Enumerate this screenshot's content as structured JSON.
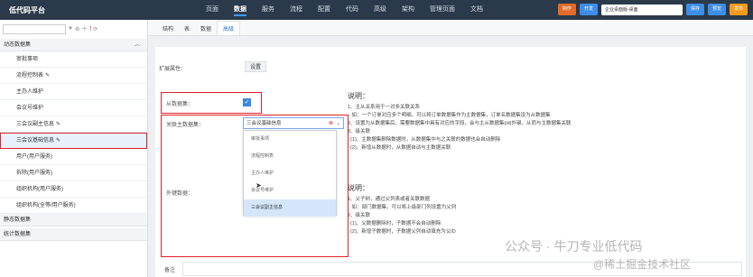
{
  "app": {
    "title": "低代码平台"
  },
  "nav": [
    "页面",
    "数据",
    "服务",
    "流程",
    "配置",
    "代码",
    "高级",
    "架构",
    "管理页面",
    "文档"
  ],
  "topbar": {
    "badge1": "制作",
    "badge2": "开发",
    "env": "企业桌面版-桌面",
    "btn_save": "保存",
    "btn_preview": "预览",
    "btn_publish": "发布"
  },
  "sidebar": {
    "search_placeholder": "",
    "group_dynamic": "动态数据集",
    "items": [
      "审批事项",
      "流程控制表",
      "主办人维护",
      "会议号维护",
      "三会议副主信息",
      "三会议基础信息",
      "用户(用户服务)",
      "拆除(用户服务)",
      "组织机构(用户服务)",
      "组织机构(全等/用户服务)"
    ],
    "group_static": "静态数据集",
    "group_stats": "统计数据集"
  },
  "tabs": [
    "结构",
    "表",
    "数据",
    "高级"
  ],
  "form": {
    "ext_label": "扩展属性：",
    "ext_button": "设置",
    "from_label": "从数据集：",
    "assoc_label": "关联主数据集：",
    "assoc_value": "三会议基础信息",
    "fk_label": "外键数据："
  },
  "dropdown": [
    "审批事项",
    "流程控制表",
    "主办人维护",
    "会议号维护",
    "三会议副主信息"
  ],
  "notes1": {
    "title": "说明：",
    "lines": [
      "1、主从关系用于一对多关联关系",
      "   如：一个订单对应多个明细，可以将订单数据集作为主数据集，订单名数据集设为从数据集",
      "2、设置为从数据集后，需要数据集中具有对应的字段，会与主从数据集(id)外键，从而与主数据集关联",
      "3、级关联",
      "  (1)、主数据集删除数据时，从数据集中与之关联的数据也会自动删除",
      "  (2)、新增从数据时，从数据自动与主数据关联"
    ]
  },
  "notes2": {
    "title": "说明：",
    "lines": [
      "1、父子树，通过父列表或者关联数据",
      "   如：部门数据集，可以将上级部门列设置为父列",
      "2、级关联",
      "  (1)、父数据删除时，子数据不会自动删除",
      "  (2)、新增子数据时，子数据父列自动填充为父ID"
    ]
  },
  "bottom_label": "备注",
  "watermark1": "公众号 · 牛刀专业低代码",
  "watermark2": "@稀土掘金技术社区",
  "colors": {
    "topbar": "#2b3a4a",
    "accent": "#3a86e6",
    "highlight_red": "#e0212a",
    "save": "#3e8ee8",
    "publish": "#f39a1f"
  }
}
